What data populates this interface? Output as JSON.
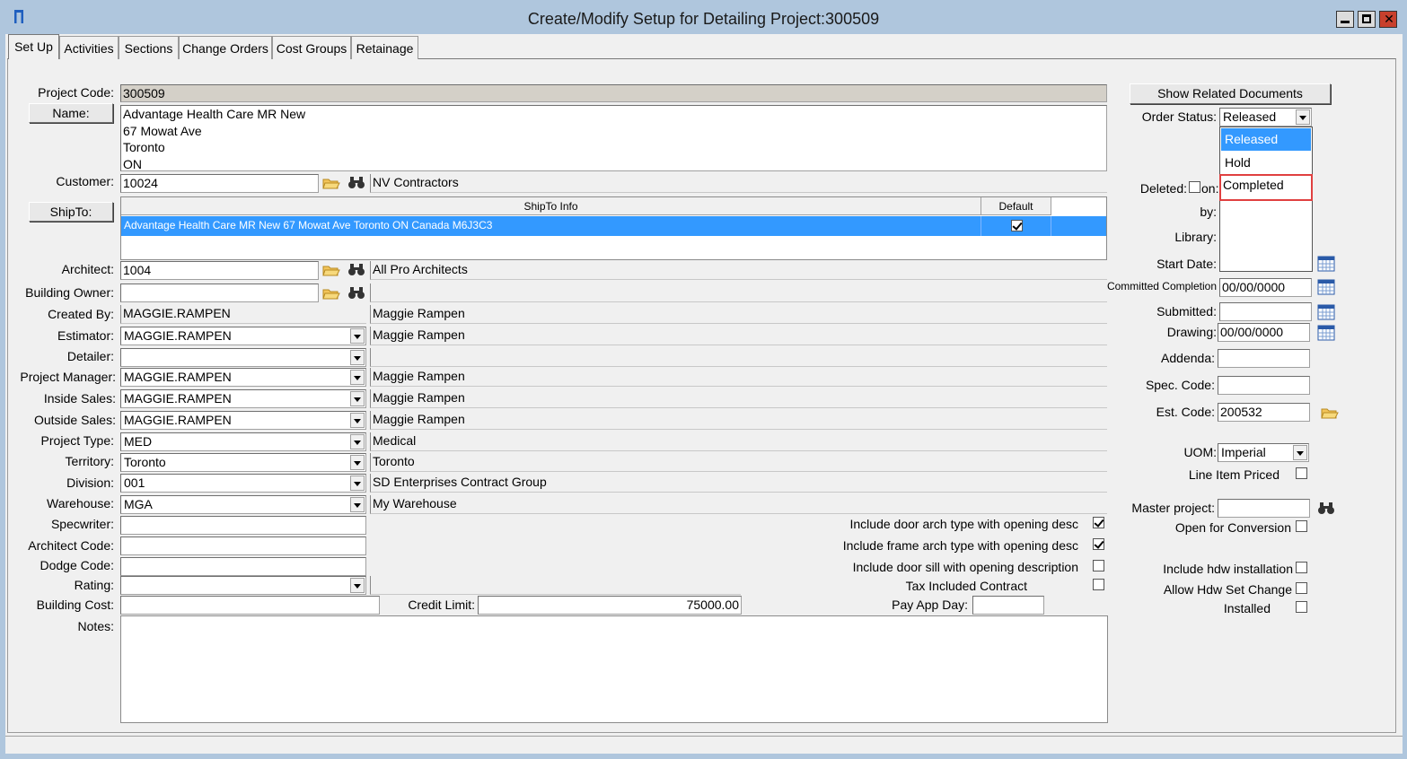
{
  "window": {
    "title": "Create/Modify Setup for Detailing Project:300509"
  },
  "tabs": [
    "Set Up",
    "Activities",
    "Sections",
    "Change Orders",
    "Cost Groups",
    "Retainage"
  ],
  "labels": {
    "project_code": "Project Code:",
    "name": "Name:",
    "customer": "Customer:",
    "shipto": "ShipTo:",
    "architect": "Architect:",
    "building_owner": "Building Owner:",
    "created_by": "Created By:",
    "estimator": "Estimator:",
    "detailer": "Detailer:",
    "project_manager": "Project Manager:",
    "inside_sales": "Inside Sales:",
    "outside_sales": "Outside Sales:",
    "project_type": "Project Type:",
    "territory": "Territory:",
    "division": "Division:",
    "warehouse": "Warehouse:",
    "specwriter": "Specwriter:",
    "architect_code": "Architect Code:",
    "dodge_code": "Dodge Code:",
    "rating": "Rating:",
    "building_cost": "Building Cost:",
    "credit_limit": "Credit Limit:",
    "notes": "Notes:",
    "pay_app_day": "Pay App Day:"
  },
  "values": {
    "project_code": "300509",
    "name_lines": "Advantage Health Care MR New\n67 Mowat Ave\nToronto\nON",
    "customer_code": "10024",
    "customer_name": "NV Contractors",
    "architect_code": "1004",
    "architect_name": "All Pro Architects",
    "building_owner_code": "",
    "building_owner_name": "",
    "created_by_code": "MAGGIE.RAMPEN",
    "created_by_name": "Maggie Rampen",
    "estimator_code": "MAGGIE.RAMPEN",
    "estimator_name": "Maggie Rampen",
    "detailer_code": "",
    "detailer_name": "",
    "pm_code": "MAGGIE.RAMPEN",
    "pm_name": "Maggie Rampen",
    "inside_code": "MAGGIE.RAMPEN",
    "inside_name": "Maggie Rampen",
    "outside_code": "MAGGIE.RAMPEN",
    "outside_name": "Maggie Rampen",
    "project_type_code": "MED",
    "project_type_name": "Medical",
    "territory_code": "Toronto",
    "territory_name": "Toronto",
    "division_code": "001",
    "division_name": "SD Enterprises Contract Group",
    "warehouse_code": "MGA",
    "warehouse_name": "My Warehouse",
    "credit_limit": "75000.00"
  },
  "shipto_grid": {
    "headers": [
      "ShipTo Info",
      "Default"
    ],
    "row": "Advantage Health Care MR New 67 Mowat Ave Toronto ON Canada M6J3C3"
  },
  "options": {
    "door_arch": "Include door arch type with opening desc",
    "frame_arch": "Include frame arch type with opening desc",
    "door_sill": "Include door sill with opening description",
    "tax_included": "Tax Included Contract"
  },
  "right": {
    "show_related": "Show Related Documents",
    "order_status_label": "Order Status:",
    "order_status_value": "Released",
    "status_options": [
      "Released",
      "Hold",
      "Completed"
    ],
    "deleted_label": "Deleted:",
    "on_label": "on:",
    "by_label": "by:",
    "library_label": "Library:",
    "start_date_label": "Start Date:",
    "committed_label": "Committed Completion",
    "committed_value": "00/00/0000",
    "submitted_label": "Submitted:",
    "drawing_label": "Drawing:",
    "drawing_value": "00/00/0000",
    "addenda_label": "Addenda:",
    "spec_code_label": "Spec. Code:",
    "est_code_label": "Est. Code:",
    "est_code_value": "200532",
    "uom_label": "UOM:",
    "uom_value": "Imperial",
    "line_item_priced": "Line Item Priced",
    "master_project_label": "Master project:",
    "open_conversion": "Open for Conversion",
    "include_hdw": "Include hdw installation",
    "allow_hdw": "Allow Hdw Set Change",
    "installed": "Installed"
  },
  "colors": {
    "selection": "#3399ff",
    "highlight_box": "#e04040",
    "frame": "#afc6dd"
  }
}
